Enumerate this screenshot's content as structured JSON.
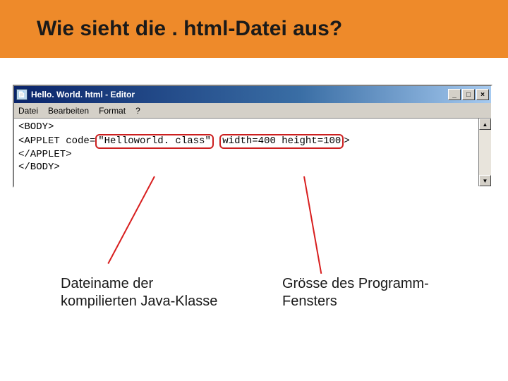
{
  "page": {
    "title": "Wie sieht die . html-Datei aus?"
  },
  "window": {
    "icon_label": "📄",
    "title": "Hello. World. html - Editor",
    "buttons": {
      "min": "_",
      "max": "□",
      "close": "×"
    }
  },
  "menu": {
    "file": "Datei",
    "edit": "Bearbeiten",
    "format": "Format",
    "help": "?"
  },
  "code": {
    "line1": "<BODY>",
    "line2_pre": "<APPLET code=",
    "line2_hl1": "\"Helloworld. class\"",
    "line2_mid": " ",
    "line2_hl2": "width=400 height=100",
    "line2_post": ">",
    "line3": "</APPLET>",
    "line4": "</BODY>"
  },
  "scroll": {
    "up": "▲",
    "down": "▼"
  },
  "captions": {
    "left_l1": "Dateiname der",
    "left_l2": "kompilierten Java-Klasse",
    "right_l1": "Grösse des Programm-",
    "right_l2": "Fensters"
  }
}
